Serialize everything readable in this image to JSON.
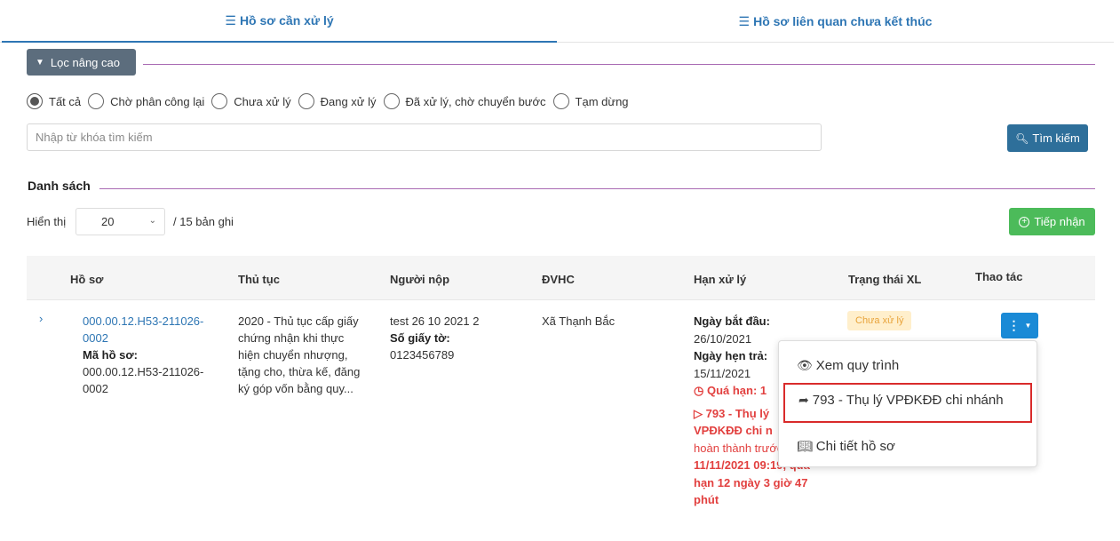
{
  "tabs": [
    {
      "icon": "list-icon",
      "label": "Hồ sơ cần xử lý",
      "active": true
    },
    {
      "icon": "list-icon",
      "label": "Hồ sơ liên quan chưa kết thúc",
      "active": false
    }
  ],
  "filter": {
    "button_label": "Lọc nâng cao",
    "icon": "chevron-down-icon"
  },
  "status_filters": [
    {
      "label": "Tất cả",
      "checked": true
    },
    {
      "label": "Chờ phân công lại",
      "checked": false
    },
    {
      "label": "Chưa xử lý",
      "checked": false
    },
    {
      "label": "Đang xử lý",
      "checked": false
    },
    {
      "label": "Đã xử lý, chờ chuyển bước",
      "checked": false
    },
    {
      "label": "Tạm dừng",
      "checked": false
    }
  ],
  "search": {
    "placeholder": "Nhập từ khóa tìm kiếm",
    "value": "",
    "button_label": "Tìm kiếm",
    "icon": "search-icon"
  },
  "list": {
    "title": "Danh sách",
    "show_label": "Hiển thị",
    "page_size": "20",
    "record_count": "/ 15 bản ghi",
    "receive_button": "Tiếp nhận",
    "receive_icon": "plus-circle-icon"
  },
  "table": {
    "headers": [
      "Hồ sơ",
      "Thủ tục",
      "Người nộp",
      "ĐVHC",
      "Hạn xử lý",
      "Trạng thái XL",
      "Thao tác"
    ],
    "row": {
      "expand_icon": "chevron-right-icon",
      "record_link_1": "000.00.12.H53-211026-",
      "record_link_2": "0002",
      "record_code_label": "Mã hồ sơ:",
      "record_code_1": "000.00.12.H53-211026-",
      "record_code_2": "0002",
      "procedure": [
        "2020 - Thủ tục cấp giấy",
        "chứng nhận khi thực",
        "hiện chuyển nhượng,",
        "tặng cho, thừa kế, đăng",
        "ký góp vốn bằng quy..."
      ],
      "submitter_name": "test 26 10 2021 2",
      "document_label": "Số giấy tờ:",
      "document_number": "0123456789",
      "admin_unit": "Xã Thạnh Bắc",
      "start_label": "Ngày bắt đầu:",
      "start_date": "26/10/2021",
      "due_label": "Ngày hẹn trả:",
      "due_date": "15/11/2021",
      "overdue_text": "Quá hạn: 1",
      "step_title_1": "793 - Thụ lý",
      "step_title_2": "VPĐKĐĐ chi n",
      "step_note": "hoàn thành trước",
      "step_deadline": "11/11/2021 09:19, quá",
      "step_overdue_1": "hạn 12 ngày 3 giờ 47",
      "step_overdue_2": "phút",
      "status": "Chưa xử lý"
    }
  },
  "action_menu": [
    {
      "icon": "eye-icon",
      "label": "Xem quy trình"
    },
    {
      "icon": "send-icon",
      "label": "793 - Thụ lý VPĐKĐĐ chi nhánh"
    },
    {
      "icon": "book-icon",
      "label": "Chi tiết hồ sơ"
    }
  ],
  "colors": {
    "primary": "#2e76b4",
    "filter_button": "#5c6d7d",
    "search_button": "#2e6f9a",
    "receive_button": "#4cbb5a",
    "action_button": "#1a8ad6",
    "overdue": "#e2403f",
    "badge_bg": "#ffefcc",
    "badge_text": "#e8a33a",
    "divider": "#a96ab3"
  }
}
